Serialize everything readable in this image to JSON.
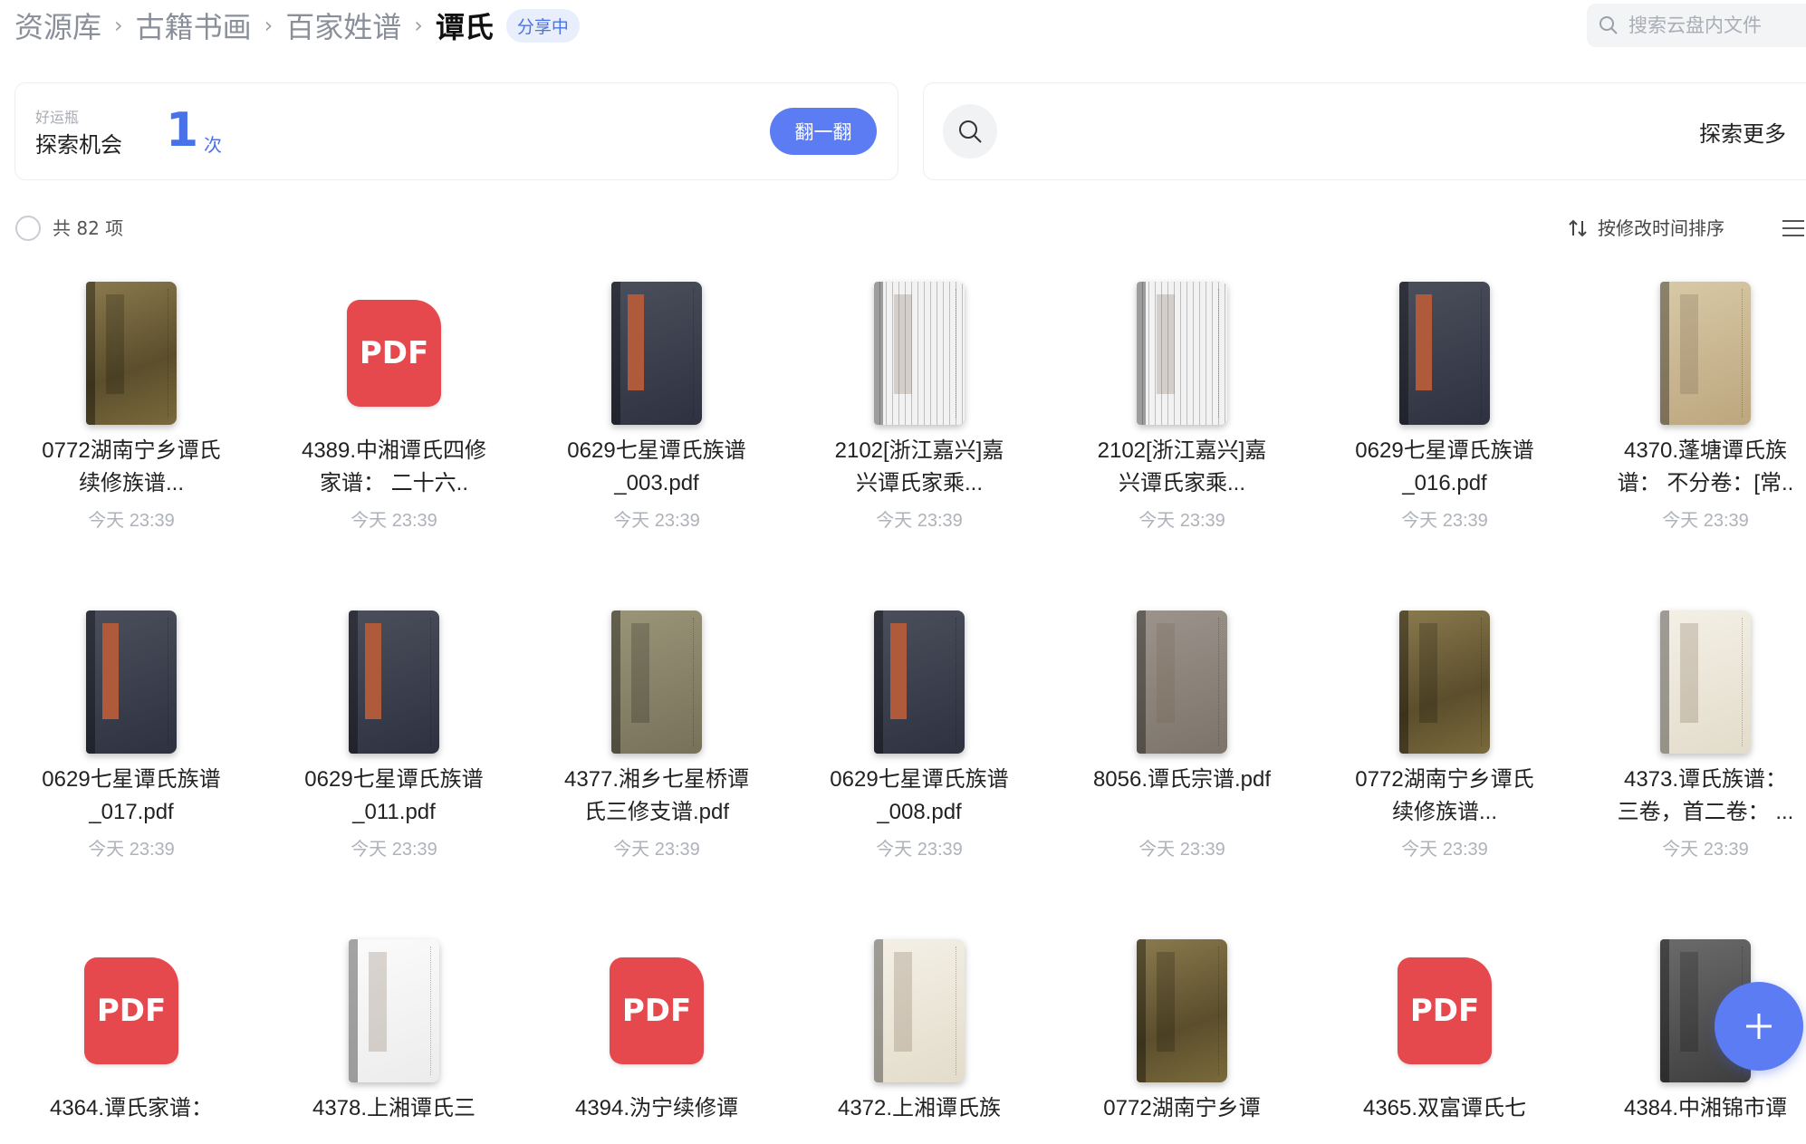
{
  "breadcrumb": {
    "items": [
      "资源库",
      "古籍书画",
      "百家姓谱"
    ],
    "current": "谭氏",
    "badge": "分享中"
  },
  "search": {
    "placeholder": "搜索云盘内文件"
  },
  "lucky": {
    "small_label": "好运瓶",
    "title": "探索机会",
    "count": "1",
    "unit": "次",
    "button": "翻一翻"
  },
  "explore": {
    "label": "探索更多"
  },
  "toolbar": {
    "count_text": "共 82 项",
    "sort_label": "按修改时间排序"
  },
  "colors": {
    "accent": "#5b7cf2",
    "pdf_red": "#e5484d"
  },
  "files": [
    {
      "name": "0772湖南宁乡谭氏续修族谱...",
      "date": "今天 23:39",
      "thumb": "book-gold"
    },
    {
      "name": "4389.中湘谭氏四修家谱： 二十六..",
      "date": "今天 23:39",
      "thumb": "pdf"
    },
    {
      "name": "0629七星谭氏族谱_003.pdf",
      "date": "今天 23:39",
      "thumb": "book-red"
    },
    {
      "name": "2102[浙江嘉兴]嘉兴谭氏家乘...",
      "date": "今天 23:39",
      "thumb": "book-page"
    },
    {
      "name": "2102[浙江嘉兴]嘉兴谭氏家乘...",
      "date": "今天 23:39",
      "thumb": "book-page"
    },
    {
      "name": "0629七星谭氏族谱_016.pdf",
      "date": "今天 23:39",
      "thumb": "book-red"
    },
    {
      "name": "4370.蓬塘谭氏族谱： 不分卷：[常..",
      "date": "今天 23:39",
      "thumb": "book-tan"
    },
    {
      "name": "0629七星谭氏族谱_017.pdf",
      "date": "今天 23:39",
      "thumb": "book-red"
    },
    {
      "name": "0629七星谭氏族谱_011.pdf",
      "date": "今天 23:39",
      "thumb": "book-red"
    },
    {
      "name": "4377.湘乡七星桥谭氏三修支谱.pdf",
      "date": "今天 23:39",
      "thumb": "book-olive"
    },
    {
      "name": "0629七星谭氏族谱_008.pdf",
      "date": "今天 23:39",
      "thumb": "book-red"
    },
    {
      "name": "8056.谭氏宗谱.pdf",
      "date": "今天 23:39",
      "thumb": "book-grey"
    },
    {
      "name": "0772湖南宁乡谭氏续修族谱...",
      "date": "今天 23:39",
      "thumb": "book-gold"
    },
    {
      "name": "4373.谭氏族谱： 三卷，首二卷： ...",
      "date": "今天 23:39",
      "thumb": "book-cream"
    },
    {
      "name": "4364.谭氏家谱：",
      "date": "",
      "thumb": "pdf"
    },
    {
      "name": "4378.上湘谭氏三",
      "date": "",
      "thumb": "book-white"
    },
    {
      "name": "4394.沩宁续修谭",
      "date": "",
      "thumb": "pdf"
    },
    {
      "name": "4372.上湘谭氏族",
      "date": "",
      "thumb": "book-cream"
    },
    {
      "name": "0772湖南宁乡谭",
      "date": "",
      "thumb": "book-gold"
    },
    {
      "name": "4365.双富谭氏七",
      "date": "",
      "thumb": "pdf"
    },
    {
      "name": "4384.中湘锦市谭",
      "date": "",
      "thumb": "book-dark"
    }
  ],
  "fab": {
    "icon": "plus-icon"
  }
}
